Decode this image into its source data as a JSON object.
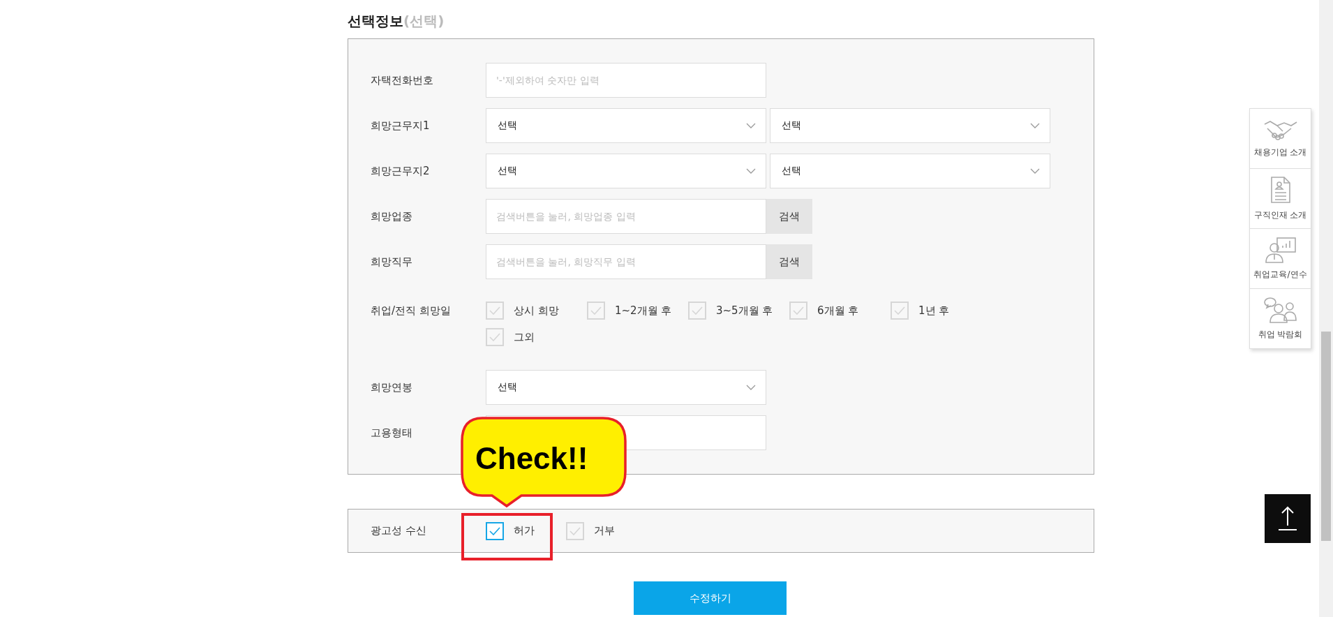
{
  "section_title": {
    "text": "선택정보",
    "note": "(선택)"
  },
  "fields": [
    {
      "kind": "text",
      "label": "자택전화번호",
      "placeholder": "'-'제외하여 숫자만 입력"
    },
    {
      "kind": "select_pair",
      "label": "희망근무지1",
      "values": [
        "선택",
        "선택"
      ]
    },
    {
      "kind": "select_pair",
      "label": "희망근무지2",
      "values": [
        "선택",
        "선택"
      ]
    },
    {
      "kind": "search",
      "label": "희망업종",
      "placeholder": "검색버튼을 눌러, 희망업종 입력",
      "button": "검색"
    },
    {
      "kind": "search",
      "label": "희망직무",
      "placeholder": "검색버튼을 눌러, 희망직무 입력",
      "button": "검색"
    },
    {
      "kind": "checks",
      "label": "취업/전직 희망일",
      "options": [
        {
          "label": "상시 희망",
          "checked": false
        },
        {
          "label": "1~2개월 후",
          "checked": false
        },
        {
          "label": "3~5개월 후",
          "checked": false
        },
        {
          "label": "6개월 후",
          "checked": false
        },
        {
          "label": "1년 후",
          "checked": false
        },
        {
          "label": "그외",
          "checked": false
        }
      ]
    },
    {
      "kind": "select",
      "label": "희망연봉",
      "value": "선택"
    },
    {
      "kind": "select",
      "label": "고용형태"
    }
  ],
  "ad_consent": {
    "label": "광고성 수신",
    "options": [
      {
        "label": "허가",
        "checked": true
      },
      {
        "label": "거부",
        "checked": false
      }
    ]
  },
  "submit_button": "수정하기",
  "callout": {
    "text": "Check!!"
  },
  "side_menu": [
    {
      "label": "채용기업 소개"
    },
    {
      "label": "구직인재 소개"
    },
    {
      "label": "취업교육/연수"
    },
    {
      "label": "취업 박람회"
    }
  ]
}
